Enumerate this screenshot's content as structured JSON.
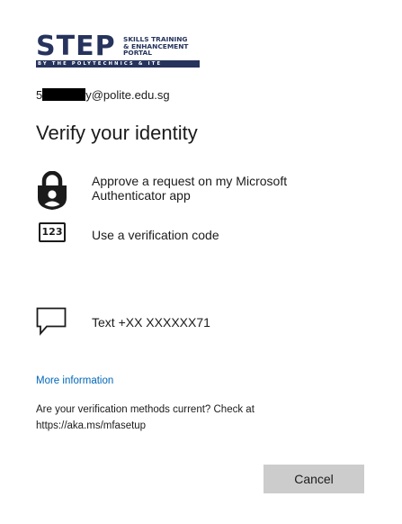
{
  "logo": {
    "wordmark": "STEP",
    "tagline_line1": "SKILLS TRAINING",
    "tagline_line2": "& ENHANCEMENT",
    "tagline_line3": "PORTAL",
    "bar_text": "BY THE POLYTECHNICS & ITE",
    "brand_color": "#26335c"
  },
  "account": {
    "prefix": "5",
    "suffix": "y@polite.edu.sg"
  },
  "title": "Verify your identity",
  "options": [
    {
      "icon": "authenticator-lock-icon",
      "label": "Approve a request on my Microsoft Authenticator app"
    },
    {
      "icon": "verification-code-icon",
      "icon_text": "123",
      "label": "Use a verification code"
    },
    {
      "icon": "text-message-icon",
      "label": "Text +XX XXXXXX71"
    }
  ],
  "more_info_label": "More information",
  "check_text": "Are your verification methods current? Check at https://aka.ms/mfasetup",
  "cancel_label": "Cancel",
  "colors": {
    "link": "#0067b8",
    "button_bg": "#cccccc",
    "text": "#1b1b1b"
  }
}
